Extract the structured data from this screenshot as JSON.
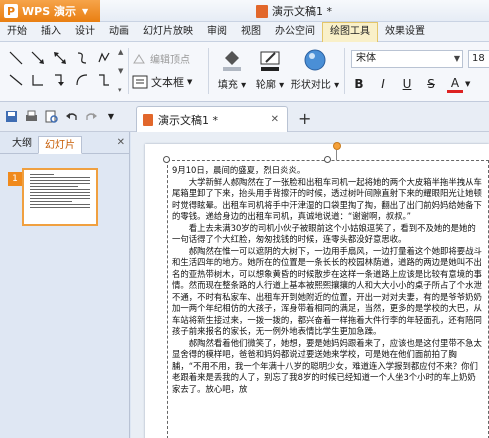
{
  "titlebar": {
    "app_name": "WPS 演示",
    "logo_letter": "P",
    "doc_title": "演示文稿1 *"
  },
  "menu": {
    "items": [
      "开始",
      "插入",
      "设计",
      "动画",
      "幻灯片放映",
      "审阅",
      "视图",
      "办公空间",
      "绘图工具",
      "效果设置"
    ],
    "active": "绘图工具"
  },
  "ribbon": {
    "edit_points_label": "编辑顶点",
    "textbox_label": "文本框",
    "fill_label": "填充",
    "outline_label": "轮廓",
    "shape_effect_label": "形状对比",
    "font_name": "宋体",
    "font_size": "18",
    "bold_label": "B",
    "italic_label": "I",
    "underline_label": "U",
    "strike_label": "S",
    "font_color_label": "A",
    "accent_color": "#e97f12"
  },
  "tabs": {
    "document_tab": "演示文稿1 *"
  },
  "left_panel": {
    "tab_outline": "大纲",
    "tab_slides": "幻灯片",
    "slide_number": "1"
  },
  "slide": {
    "paragraphs": [
      "9月10日，晨间的盛夏，烈日炎炎。",
      "　　大学新鲜人郝陶然在了一张脸和出租车司机一起将她的两个大皮箱半拖半拽从车尾箱里卸了下来，抬头用手背擦汗的时候，透过树叶间隙直射下来的耀眼阳光让她顿时觉得眩晕。出租车司机将手中汗津湿的口袋里掏了掏，翻出了出门前妈妈给她备下的零钱。递给身边的出租车司机，真诚地说道：“谢谢啊，叔叔。”",
      "　　看上去未满30岁的司机小伙子被眼前这个小姑娘逗笑了，看到不及她的是她的一句话得了个大红脸，匆匆找钱的时候，连零头都没好意思收。",
      "　　郝陶然在惟一可以遮阴的大树下，一边用手扇风，一边打量着这个她即将要战斗和生活四年的地方。她所在的位置是一条长长的校园林荫道，道路的两边是她叫不出名的亚热带树木，可以想象黄昏的时候散步在这样一条道路上应该是比较有意境的事情。然而现在整条路的人行道上基本被熙熙攘攘的人和大大小小的桌子所占了个水泄不通，不时有私家车、出租车开到她附近的位置，开出一对对夫妻，有的是爷爷奶奶加一两个年纪相仿的大孩子，浑身带着相同的满足，当然，更多的是学校的大巴，从车站将新生接过来，一拨一拨的，都兴奋着一样拖着大件行李的年轻面孔，还有陪同孩子前来报名的家长，无一例外地表情比学生更加急躁。",
      "　　郝陶然看着他们微笑了，她想，要是她妈妈跟着来了，应该也是这付里带不急太显舍得的模样吧，爸爸和妈妈都说过要送她来学校，可是她在他们面前拍了胸脯，“不用不用，我一个年满十八岁的聪明少女，难道连入学报到都应付不来？你们老跟着来是丢我的人了，别忘了我8岁的时候已经知道一个人坐3个小时的车上奶奶家去了。放心吧，放"
    ]
  }
}
